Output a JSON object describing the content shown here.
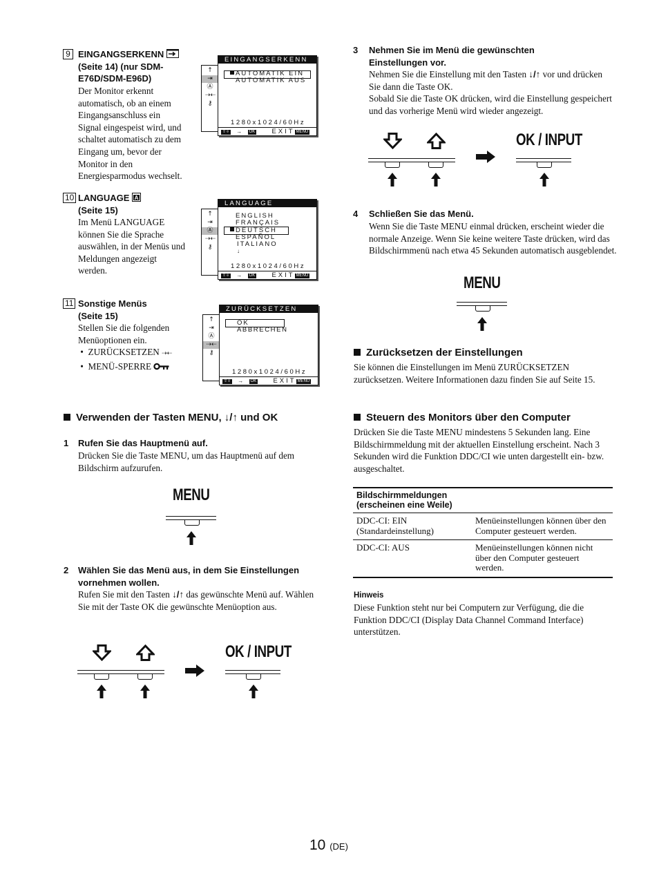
{
  "left_column": {
    "items": [
      {
        "number": "9",
        "title_lines": [
          "EINGANGSERKENN",
          "(Seite 14) (nur SDM-",
          "E76D/SDM-E96D)"
        ],
        "body_lines": [
          "Der Monitor erkennt",
          "automatisch, ob an einem",
          "Eingangsanschluss ein",
          "Signal eingespeist wird, und",
          "schaltet automatisch zu dem",
          "Eingang um, bevor der",
          "Monitor in den",
          "Energiesparmodus wechselt."
        ],
        "icon": "input-sense-icon"
      },
      {
        "number": "10",
        "title_lines": [
          "LANGUAGE",
          "(Seite 15)"
        ],
        "body_lines": [
          "Im Menü LANGUAGE",
          "können Sie die Sprache",
          "auswählen, in der Menüs und",
          "Meldungen angezeigt",
          "werden."
        ],
        "icon": "language-icon"
      },
      {
        "number": "11",
        "title_lines": [
          "Sonstige Menüs",
          "(Seite 15)"
        ],
        "body_lines": [
          "Stellen Sie die folgenden",
          "Menüoptionen ein."
        ],
        "bullets": [
          "ZURÜCKSETZEN",
          "MENÜ-SPERRE"
        ]
      }
    ],
    "osd_menus": [
      {
        "title": "EINGANGSERKENN",
        "options": [
          "AUTOMATIK EIN",
          "AUTOMATIK AUS"
        ],
        "selected": "AUTOMATIK EIN",
        "resolution": "1280x1024/60Hz",
        "footer_ok": "OK",
        "footer_exit": "EXIT",
        "footer_menu": "MENU"
      },
      {
        "title": "LANGUAGE",
        "options": [
          "ENGLISH",
          "FRANÇAIS",
          "DEUTSCH",
          "ESPAÑOL",
          "ITALIANO"
        ],
        "selected": "DEUTSCH",
        "resolution": "1280x1024/60Hz",
        "footer_ok": "OK",
        "footer_exit": "EXIT",
        "footer_menu": "MENU"
      },
      {
        "title": "ZURÜCKSETZEN",
        "options": [
          "OK",
          "ABBRECHEN"
        ],
        "selected": "OK",
        "resolution": "1280x1024/60Hz",
        "footer_ok": "OK",
        "footer_exit": "EXIT",
        "footer_menu": "MENU"
      }
    ],
    "section_buttons": {
      "heading_pre": "Verwenden der Tasten MENU,",
      "heading_arrows": "↓/↑",
      "heading_post": "und OK",
      "steps": [
        {
          "number": "1",
          "title": "Rufen Sie das Hauptmenü auf.",
          "body": "Drücken Sie die Taste MENU, um das Hauptmenü auf dem Bildschirm aufzurufen.",
          "diagram_label": "MENU"
        },
        {
          "number": "2",
          "title": "Wählen Sie das Menü aus, in dem Sie Einstellungen vornehmen wollen.",
          "body_pre": "Rufen Sie mit den Tasten",
          "body_arrows": "↓/↑",
          "body_post": "das gewünschte Menü auf. Wählen Sie mit der Taste OK die gewünschte Menüoption aus.",
          "diagram_label": "OK / INPUT"
        }
      ]
    }
  },
  "right_column": {
    "steps": [
      {
        "number": "3",
        "title": "Nehmen Sie im Menü die gewünschten Einstellungen vor.",
        "body_pre": "Nehmen Sie die Einstellung mit den Tasten",
        "body_arrows": "↓/↑",
        "body_post": "vor und drücken Sie dann die Taste OK.",
        "body2": "Sobald Sie die Taste OK drücken, wird die Einstellung gespeichert und das vorherige Menü wird wieder angezeigt.",
        "diagram_label": "OK / INPUT"
      },
      {
        "number": "4",
        "title": "Schließen Sie das Menü.",
        "body": "Wenn Sie die Taste MENU einmal drücken, erscheint wieder die normale Anzeige. Wenn Sie keine weitere Taste drücken, wird das Bildschirmmenü nach etwa 45 Sekunden automatisch ausgeblendet.",
        "diagram_label": "MENU"
      }
    ],
    "reset_section": {
      "heading": "Zurücksetzen der Einstellungen",
      "body": "Sie können die Einstellungen im Menü ZURÜCKSETZEN zurücksetzen. Weitere Informationen dazu finden Sie auf Seite 15."
    },
    "computer_section": {
      "heading": "Steuern des Monitors über den Computer",
      "body": "Drücken Sie die Taste MENU mindestens 5 Sekunden lang. Eine Bildschirmmeldung mit der aktuellen Einstellung erscheint. Nach 3 Sekunden wird die Funktion DDC/CI wie unten dargestellt ein- bzw. ausgeschaltet.",
      "table": {
        "header_line1": "Bildschirmmeldungen",
        "header_line2": "(erscheinen eine Weile)",
        "rows": [
          {
            "message_line1": "DDC-CI: EIN",
            "message_line2": "(Standardeinstellung)",
            "description": "Menüeinstellungen können über den Computer gesteuert werden."
          },
          {
            "message_line1": "DDC-CI: AUS",
            "message_line2": "",
            "description": "Menüeinstellungen können nicht über den Computer gesteuert werden."
          }
        ]
      },
      "note_title": "Hinweis",
      "note_body": "Diese Funktion steht nur bei Computern zur Verfügung, die die Funktion DDC/CI (Display Data Channel Command Interface) unterstützen."
    }
  },
  "footer": {
    "page_number": "10",
    "language_code": "(DE)"
  }
}
